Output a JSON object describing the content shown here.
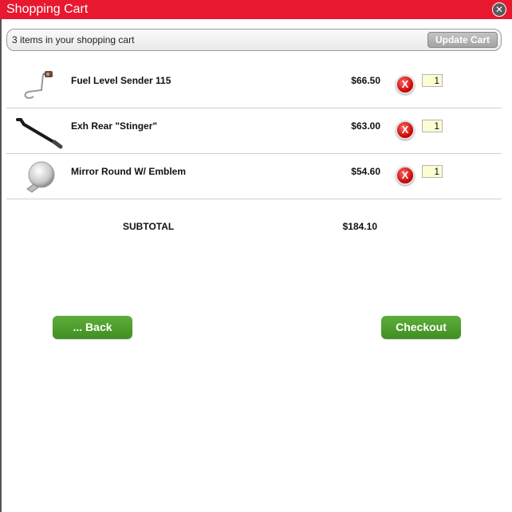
{
  "window": {
    "title": "Shopping Cart",
    "close_icon": "close-icon"
  },
  "cart_bar": {
    "count_text": "3 items in your shopping cart",
    "update_label": "Update Cart"
  },
  "items": [
    {
      "name": "Fuel Level Sender 115",
      "price": "$66.50",
      "qty": "1",
      "icon": "fuel-sender-icon"
    },
    {
      "name": "Exh Rear \"Stinger\"",
      "price": "$63.00",
      "qty": "1",
      "icon": "exhaust-pipe-icon"
    },
    {
      "name": "Mirror Round W/ Emblem",
      "price": "$54.60",
      "qty": "1",
      "icon": "mirror-icon"
    }
  ],
  "summary": {
    "subtotal_label": "SUBTOTAL",
    "subtotal_value": "$184.10"
  },
  "actions": {
    "back_label": "... Back",
    "checkout_label": "Checkout"
  },
  "colors": {
    "titlebar": "#e8182f",
    "button_green": "#4b9c2c",
    "remove_red": "#c40000",
    "qty_bg": "#fdfdd2"
  }
}
